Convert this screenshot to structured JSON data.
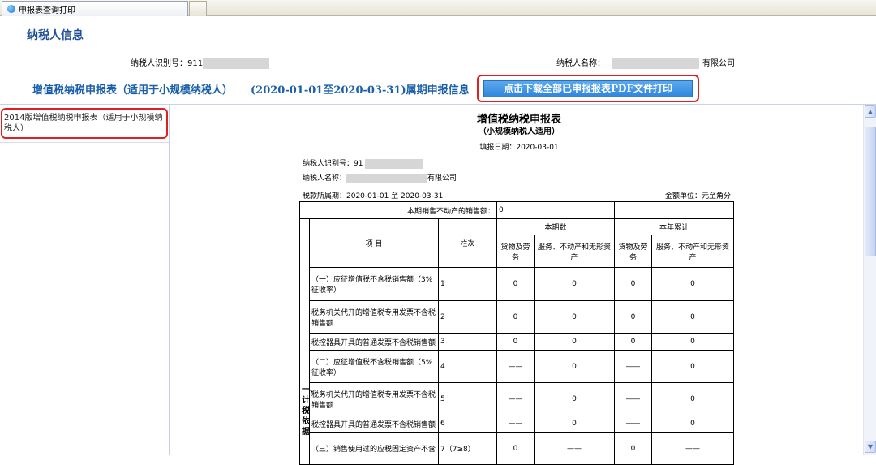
{
  "tab": {
    "title": "申报表查询打印"
  },
  "header": {
    "section_title": "纳税人信息",
    "taxpayer_id_label": "纳税人识别号：",
    "taxpayer_id_prefix": "911",
    "taxpayer_name_label": "纳税人名称：",
    "taxpayer_name_suffix": "有限公司",
    "period_title": "增值税纳税申报表（适用于小规模纳税人）",
    "period_range": "(2020-01-01至2020-03-31)属期申报信息",
    "download_button": "点击下载全部已申报报表PDF文件打印"
  },
  "sidebar": {
    "items": [
      {
        "label": "2014版增值税纳税申报表（适用于小规模纳税人）"
      }
    ]
  },
  "form": {
    "title": "增值税纳税申报表",
    "subtitle": "（小规模纳税人适用）",
    "fill_date": "填报日期：2020-03-01",
    "taxpayer_id_label": "纳税人识别号：",
    "taxpayer_id_prefix": "91",
    "taxpayer_name_label": "纳税人名称：",
    "taxpayer_name_suffix": "有限公司",
    "tax_period": "税款所属期：2020-01-01 至 2020-03-31",
    "amount_unit": "金额单位：元至角分",
    "immovable_sales_label": "本期销售不动产的销售额：",
    "immovable_sales_value": "0",
    "col_current": "本期数",
    "col_ytd": "本年累计",
    "col_item": "项 目",
    "col_line": "栏次",
    "col_goods": "货物及劳务",
    "col_services": "服务、不动产和无形资产",
    "side_label": "一、计税依据",
    "rows": [
      {
        "item": "（一）应征增值税不含税销售额（3%征收率）",
        "line": "1",
        "v1": "0",
        "v2": "0",
        "v3": "0",
        "v4": "0"
      },
      {
        "item": "税务机关代开的增值税专用发票不含税销售额",
        "line": "2",
        "v1": "0",
        "v2": "0",
        "v3": "0",
        "v4": "0"
      },
      {
        "item": "税控器具开具的普通发票不含税销售额",
        "line": "3",
        "v1": "0",
        "v2": "0",
        "v3": "0",
        "v4": "0"
      },
      {
        "item": "（二）应征增值税不含税销售额（5%征收率）",
        "line": "4",
        "v1": "——",
        "v2": "0",
        "v3": "——",
        "v4": "0"
      },
      {
        "item": "税务机关代开的增值税专用发票不含税销售额",
        "line": "5",
        "v1": "——",
        "v2": "0",
        "v3": "——",
        "v4": "0"
      },
      {
        "item": "税控器具开具的普通发票不含税销售额",
        "line": "6",
        "v1": "——",
        "v2": "0",
        "v3": "——",
        "v4": "0"
      },
      {
        "item": "（三）销售使用过的应税固定资产不含",
        "line": "7（7≥8）",
        "v1": "0",
        "v2": "——",
        "v3": "0",
        "v4": "——"
      }
    ]
  },
  "colors": {
    "title_blue": "#1e4f97",
    "button_blue": "#3a8fe0",
    "highlight_red": "#e02020"
  }
}
